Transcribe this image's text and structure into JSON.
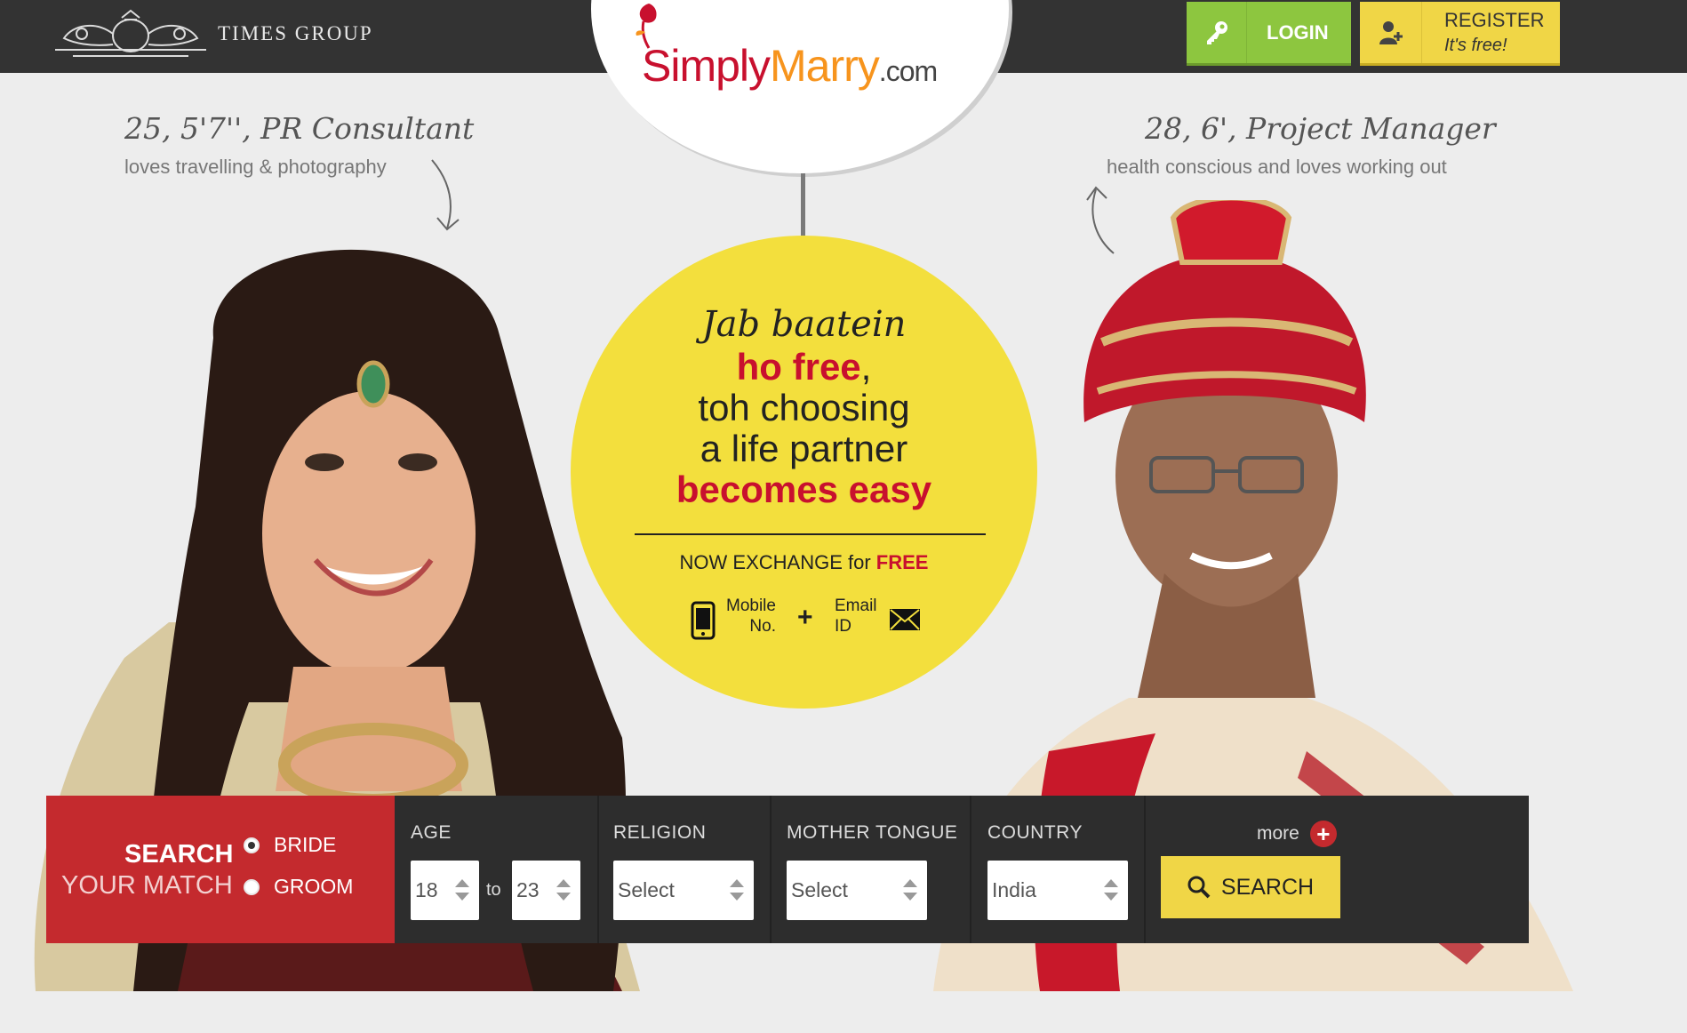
{
  "header": {
    "brand": "TIMES GROUP",
    "login_label": "LOGIN",
    "register_label": "REGISTER",
    "register_sub": "It's free!"
  },
  "logo": {
    "simply": "Simply",
    "marry": "Marry",
    "dotcom": ".com"
  },
  "profiles": {
    "bride": {
      "title": "25, 5'7'', PR Consultant",
      "subtitle": "loves travelling & photography"
    },
    "groom": {
      "title": "28, 6', Project Manager",
      "subtitle": "health conscious and loves working out"
    }
  },
  "tagline": {
    "line1": "Jab baatein",
    "line2": "ho free",
    "line2_suffix": ",",
    "line3": "toh choosing",
    "line4": "a life partner",
    "line5": "becomes easy",
    "exchange_prefix": "NOW EXCHANGE for",
    "exchange_free": "FREE",
    "mobile_1": "Mobile",
    "mobile_2": "No.",
    "email_1": "Email",
    "email_2": "ID",
    "plus": "+"
  },
  "search": {
    "title1": "SEARCH",
    "title2": "YOUR MATCH",
    "options": [
      {
        "label": "BRIDE",
        "selected": true
      },
      {
        "label": "GROOM",
        "selected": false
      }
    ],
    "age_label": "AGE",
    "age_from": "18",
    "age_to_label": "to",
    "age_to": "23",
    "religion_label": "RELIGION",
    "religion_value": "Select",
    "mother_tongue_label": "MOTHER TONGUE",
    "mother_tongue_value": "Select",
    "country_label": "COUNTRY",
    "country_value": "India",
    "more_label": "more",
    "button_label": "SEARCH"
  },
  "colors": {
    "topbar": "#333333",
    "login_green": "#8dc63f",
    "register_yellow": "#f0d646",
    "brand_red": "#c8102e",
    "tag_yellow": "#f3df3d",
    "search_red": "#c42a2e",
    "search_dark": "#2d2d2d"
  }
}
